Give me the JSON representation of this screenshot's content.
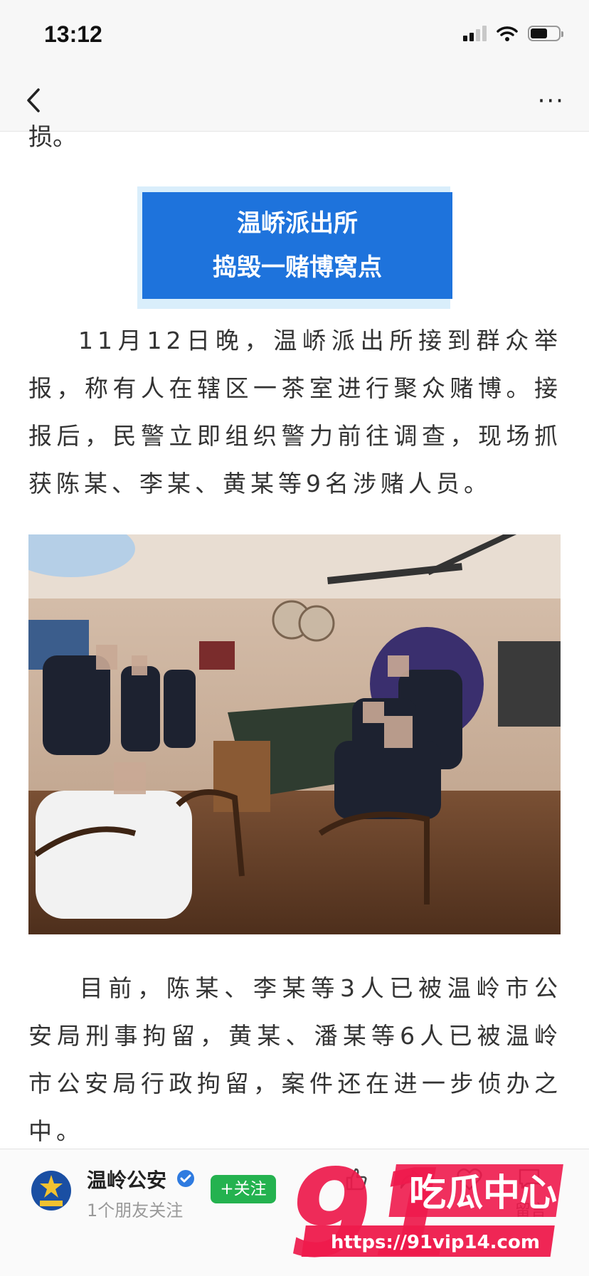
{
  "status": {
    "time": "13:12"
  },
  "nav": {
    "more_label": "···"
  },
  "article": {
    "cut_text": "损。",
    "banner_line1": "温峤派出所",
    "banner_line2": "捣毁一赌博窝点",
    "paragraph1": "11月12日晚，温峤派出所接到群众举报，称有人在辖区一茶室进行聚众赌博。接报后，民警立即组织警力前往调查，现场抓获陈某、李某、黄某等9名涉赌人员。",
    "paragraph2": "目前，陈某、李某等3人已被温岭市公安局刑事拘留，黄某、潘某等6人已被温岭市公安局行政拘留，案件还在进一步侦办之中。"
  },
  "account": {
    "name": "温岭公安",
    "subtitle": "1个朋友关注",
    "follow_label": "+关注"
  },
  "actions": {
    "comment_label": "留言"
  },
  "watermark": {
    "big_text": "91",
    "side_text": "吃瓜中心",
    "url": "https://91vip14.com"
  },
  "colors": {
    "banner": "#1e73dc",
    "follow": "#24b24f",
    "watermark": "#ee1a4c"
  }
}
